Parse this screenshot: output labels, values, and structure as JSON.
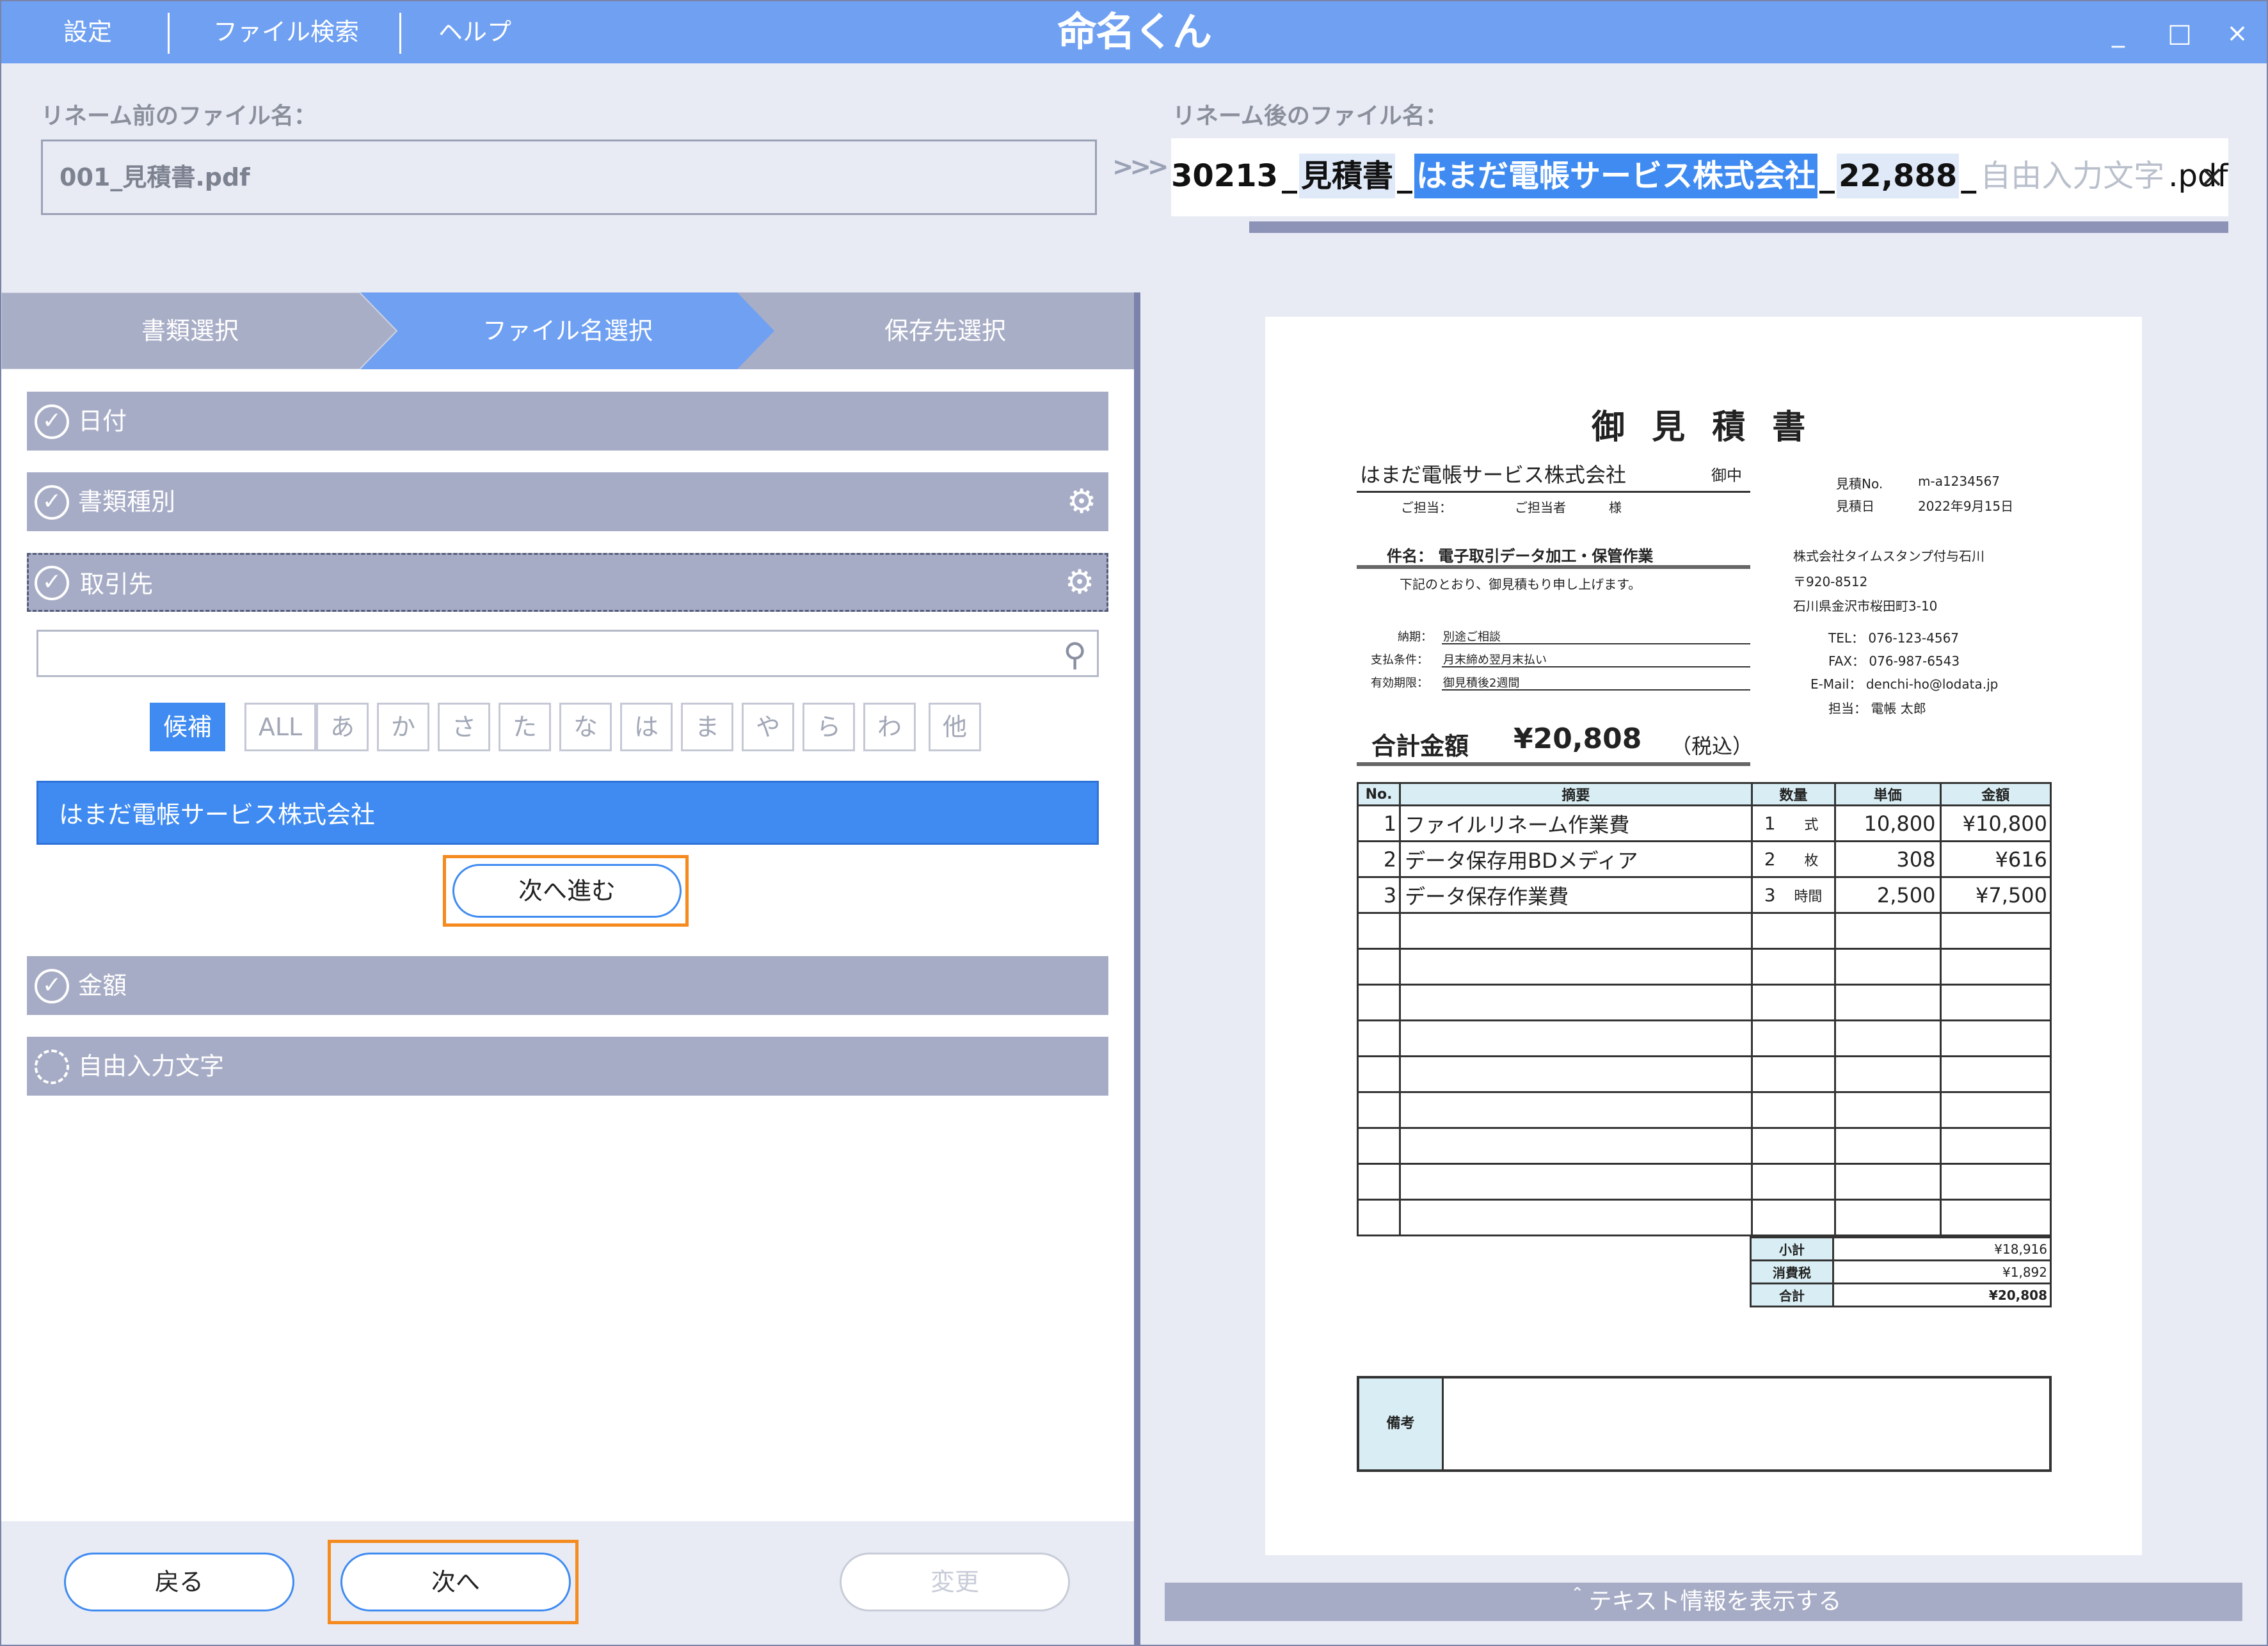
{
  "menu": {
    "settings": "設定",
    "file_search": "ファイル検索",
    "help": "ヘルプ"
  },
  "app": {
    "title": "命名くん"
  },
  "window": {
    "minimize": "_",
    "maximize": "□",
    "close": "×"
  },
  "rename": {
    "before_label": "リネーム前のファイル名：",
    "before_value": "001_見積書.pdf",
    "after_label": "リネーム後のファイル名：",
    "arrows": ">>>",
    "after_parts": {
      "date": "30213",
      "sep1": "_",
      "doctype": "見積書",
      "sep2": "_",
      "partner": "はまだ電帳サービス株式会社",
      "sep3": "_",
      "amount": "22,888",
      "sep4": "_",
      "free": "自由入力文字",
      "ext": ".pdf"
    },
    "clear": "×"
  },
  "steps": [
    "書類選択",
    "ファイル名選択",
    "保存先選択"
  ],
  "sections": {
    "date": "日付",
    "doctype": "書類種別",
    "partner": "取引先",
    "amount": "金額",
    "free": "自由入力文字"
  },
  "search": {
    "value": "",
    "placeholder": ""
  },
  "kana_tabs": [
    "候補",
    "ALL",
    "あ",
    "か",
    "さ",
    "た",
    "な",
    "は",
    "ま",
    "や",
    "ら",
    "わ",
    "他"
  ],
  "candidate": "はまだ電帳サービス株式会社",
  "buttons": {
    "next_step": "次へ進む",
    "back": "戻る",
    "next": "次へ",
    "change": "変更"
  },
  "text_info": "＾テキスト情報を表示する",
  "doc": {
    "title": "御 見 積 書",
    "client": "はまだ電帳サービス株式会社",
    "honorific": "御中",
    "tanto_label": "ご担当：",
    "tanto_value": "ご担当者",
    "sama": "様",
    "quote_no_label": "見積No.",
    "quote_no": "m-a1234567",
    "quote_date_label": "見積日",
    "quote_date": "2022年9月15日",
    "subject": "件名：  電子取引データ加工・保管作業",
    "intro": "下記のとおり、御見積もり申し上げます。",
    "issuer": "株式会社タイムスタンプ付与石川",
    "zip": "〒920-8512",
    "addr": "石川県金沢市桜田町3-10",
    "tel": "TEL：  076-123-4567",
    "fax": "FAX：  076-987-6543",
    "email": "E-Mail：  denchi-ho@lodata.jp",
    "staff": "担当：  電帳  太郎",
    "delivery_label": "納期：",
    "delivery": "別途ご相談",
    "payment_label": "支払条件：",
    "payment": "月末締め翌月末払い",
    "validity_label": "有効期限：",
    "validity": "御見積後2週間",
    "total_label": "合計金額",
    "total_value": "¥20,808",
    "tax_incl": "（税込）",
    "headers": [
      "No.",
      "摘要",
      "数量",
      "単価",
      "金額"
    ],
    "rows": [
      {
        "no": "1",
        "desc": "ファイルリネーム作業費",
        "qty": "1",
        "unit": "式",
        "price": "10,800",
        "amount": "¥10,800"
      },
      {
        "no": "2",
        "desc": "データ保存用BDメディア",
        "qty": "2",
        "unit": "枚",
        "price": "308",
        "amount": "¥616"
      },
      {
        "no": "3",
        "desc": "データ保存作業費",
        "qty": "3",
        "unit": "時間",
        "price": "2,500",
        "amount": "¥7,500"
      }
    ],
    "subtotal_label": "小計",
    "subtotal": "¥18,916",
    "tax_label": "消費税",
    "tax": "¥1,892",
    "grand_label": "合計",
    "grand": "¥20,808",
    "remarks_label": "備考"
  },
  "colors": {
    "accent": "#3f8bf1",
    "titlebar": "#6fa0f2",
    "section": "#a7acc6",
    "highlight": "#f58a1f"
  }
}
